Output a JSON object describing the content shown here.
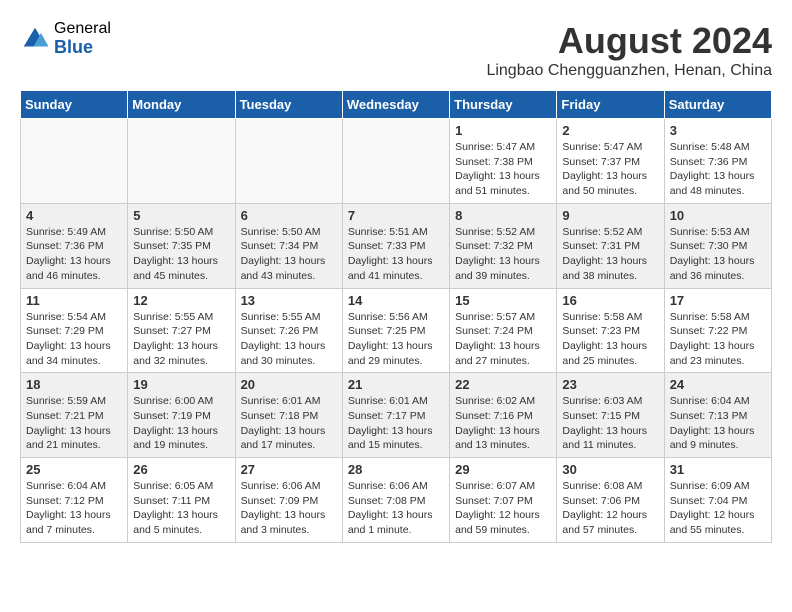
{
  "logo": {
    "general": "General",
    "blue": "Blue"
  },
  "title": {
    "month_year": "August 2024",
    "location": "Lingbao Chengguanzhen, Henan, China"
  },
  "headers": [
    "Sunday",
    "Monday",
    "Tuesday",
    "Wednesday",
    "Thursday",
    "Friday",
    "Saturday"
  ],
  "weeks": [
    {
      "shaded": false,
      "days": [
        {
          "date": "",
          "info": ""
        },
        {
          "date": "",
          "info": ""
        },
        {
          "date": "",
          "info": ""
        },
        {
          "date": "",
          "info": ""
        },
        {
          "date": "1",
          "info": "Sunrise: 5:47 AM\nSunset: 7:38 PM\nDaylight: 13 hours\nand 51 minutes."
        },
        {
          "date": "2",
          "info": "Sunrise: 5:47 AM\nSunset: 7:37 PM\nDaylight: 13 hours\nand 50 minutes."
        },
        {
          "date": "3",
          "info": "Sunrise: 5:48 AM\nSunset: 7:36 PM\nDaylight: 13 hours\nand 48 minutes."
        }
      ]
    },
    {
      "shaded": true,
      "days": [
        {
          "date": "4",
          "info": "Sunrise: 5:49 AM\nSunset: 7:36 PM\nDaylight: 13 hours\nand 46 minutes."
        },
        {
          "date": "5",
          "info": "Sunrise: 5:50 AM\nSunset: 7:35 PM\nDaylight: 13 hours\nand 45 minutes."
        },
        {
          "date": "6",
          "info": "Sunrise: 5:50 AM\nSunset: 7:34 PM\nDaylight: 13 hours\nand 43 minutes."
        },
        {
          "date": "7",
          "info": "Sunrise: 5:51 AM\nSunset: 7:33 PM\nDaylight: 13 hours\nand 41 minutes."
        },
        {
          "date": "8",
          "info": "Sunrise: 5:52 AM\nSunset: 7:32 PM\nDaylight: 13 hours\nand 39 minutes."
        },
        {
          "date": "9",
          "info": "Sunrise: 5:52 AM\nSunset: 7:31 PM\nDaylight: 13 hours\nand 38 minutes."
        },
        {
          "date": "10",
          "info": "Sunrise: 5:53 AM\nSunset: 7:30 PM\nDaylight: 13 hours\nand 36 minutes."
        }
      ]
    },
    {
      "shaded": false,
      "days": [
        {
          "date": "11",
          "info": "Sunrise: 5:54 AM\nSunset: 7:29 PM\nDaylight: 13 hours\nand 34 minutes."
        },
        {
          "date": "12",
          "info": "Sunrise: 5:55 AM\nSunset: 7:27 PM\nDaylight: 13 hours\nand 32 minutes."
        },
        {
          "date": "13",
          "info": "Sunrise: 5:55 AM\nSunset: 7:26 PM\nDaylight: 13 hours\nand 30 minutes."
        },
        {
          "date": "14",
          "info": "Sunrise: 5:56 AM\nSunset: 7:25 PM\nDaylight: 13 hours\nand 29 minutes."
        },
        {
          "date": "15",
          "info": "Sunrise: 5:57 AM\nSunset: 7:24 PM\nDaylight: 13 hours\nand 27 minutes."
        },
        {
          "date": "16",
          "info": "Sunrise: 5:58 AM\nSunset: 7:23 PM\nDaylight: 13 hours\nand 25 minutes."
        },
        {
          "date": "17",
          "info": "Sunrise: 5:58 AM\nSunset: 7:22 PM\nDaylight: 13 hours\nand 23 minutes."
        }
      ]
    },
    {
      "shaded": true,
      "days": [
        {
          "date": "18",
          "info": "Sunrise: 5:59 AM\nSunset: 7:21 PM\nDaylight: 13 hours\nand 21 minutes."
        },
        {
          "date": "19",
          "info": "Sunrise: 6:00 AM\nSunset: 7:19 PM\nDaylight: 13 hours\nand 19 minutes."
        },
        {
          "date": "20",
          "info": "Sunrise: 6:01 AM\nSunset: 7:18 PM\nDaylight: 13 hours\nand 17 minutes."
        },
        {
          "date": "21",
          "info": "Sunrise: 6:01 AM\nSunset: 7:17 PM\nDaylight: 13 hours\nand 15 minutes."
        },
        {
          "date": "22",
          "info": "Sunrise: 6:02 AM\nSunset: 7:16 PM\nDaylight: 13 hours\nand 13 minutes."
        },
        {
          "date": "23",
          "info": "Sunrise: 6:03 AM\nSunset: 7:15 PM\nDaylight: 13 hours\nand 11 minutes."
        },
        {
          "date": "24",
          "info": "Sunrise: 6:04 AM\nSunset: 7:13 PM\nDaylight: 13 hours\nand 9 minutes."
        }
      ]
    },
    {
      "shaded": false,
      "days": [
        {
          "date": "25",
          "info": "Sunrise: 6:04 AM\nSunset: 7:12 PM\nDaylight: 13 hours\nand 7 minutes."
        },
        {
          "date": "26",
          "info": "Sunrise: 6:05 AM\nSunset: 7:11 PM\nDaylight: 13 hours\nand 5 minutes."
        },
        {
          "date": "27",
          "info": "Sunrise: 6:06 AM\nSunset: 7:09 PM\nDaylight: 13 hours\nand 3 minutes."
        },
        {
          "date": "28",
          "info": "Sunrise: 6:06 AM\nSunset: 7:08 PM\nDaylight: 13 hours\nand 1 minute."
        },
        {
          "date": "29",
          "info": "Sunrise: 6:07 AM\nSunset: 7:07 PM\nDaylight: 12 hours\nand 59 minutes."
        },
        {
          "date": "30",
          "info": "Sunrise: 6:08 AM\nSunset: 7:06 PM\nDaylight: 12 hours\nand 57 minutes."
        },
        {
          "date": "31",
          "info": "Sunrise: 6:09 AM\nSunset: 7:04 PM\nDaylight: 12 hours\nand 55 minutes."
        }
      ]
    }
  ]
}
